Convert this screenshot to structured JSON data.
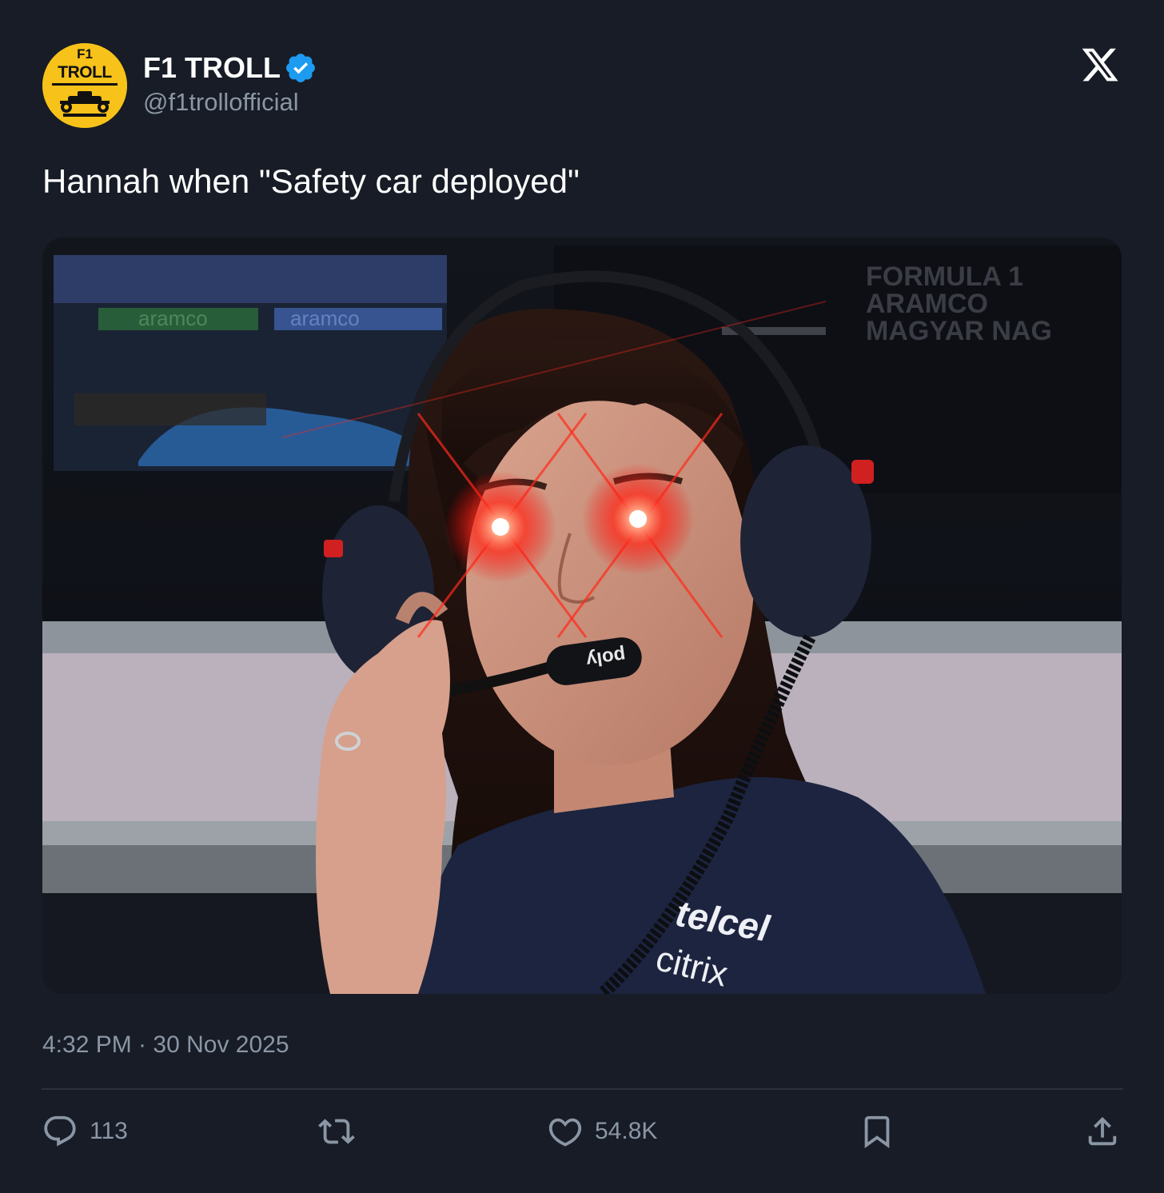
{
  "author": {
    "display_name": "F1 TROLL",
    "handle": "@f1trollofficial",
    "verified": true,
    "avatar_text_top": "F1",
    "avatar_text_main": "TROLL",
    "avatar_color": "#f7c219"
  },
  "platform_icon": "x-logo-icon",
  "tweet": {
    "text": "Hannah when \"Safety car deployed\"",
    "timestamp": "4:32 PM · 30 Nov 2025"
  },
  "media": {
    "background_signage": [
      "FORMULA 1",
      "ARAMCO",
      "MAGYAR NAG"
    ],
    "banner_text": "aramco",
    "mic_brand": "poly",
    "shirt_sponsors": [
      "telcel",
      "citrix"
    ]
  },
  "actions": {
    "replies": {
      "icon": "reply-icon",
      "count": "113"
    },
    "retweets": {
      "icon": "retweet-icon"
    },
    "likes": {
      "icon": "heart-icon",
      "count": "54.8K"
    },
    "bookmark": {
      "icon": "bookmark-icon"
    },
    "share": {
      "icon": "share-icon"
    }
  },
  "colors": {
    "background": "#171c26",
    "text": "#ffffff",
    "muted": "#8b96a5",
    "verified": "#1d9bf0",
    "divider": "#2b323d"
  }
}
